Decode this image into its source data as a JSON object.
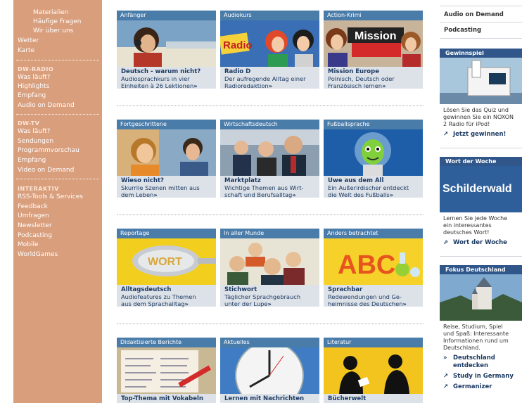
{
  "sidebar": {
    "top_items": [
      "Materialien",
      "Häufige Fragen",
      "Wir über uns"
    ],
    "main_items": [
      "Wetter",
      "Karte"
    ],
    "radio_head": "DW-RADIO",
    "radio_items": [
      "Was läuft?",
      "Highlights",
      "Empfang",
      "Audio on Demand"
    ],
    "tv_head": "DW-TV",
    "tv_items": [
      "Was läuft?",
      "Sendungen",
      "Programmvorschau",
      "Empfang",
      "Video on Demand"
    ],
    "inter_head": "INTERAKTIV",
    "inter_items": [
      "RSS-Tools & Services",
      "Feedback",
      "Umfragen",
      "Newsletter",
      "Podcasting",
      "Mobile",
      "WorldGames"
    ]
  },
  "cards": [
    {
      "header": "Anfänger",
      "title": "Deutsch - warum nicht?",
      "desc": "Audiosprachkurs in vier\nEinheiten à 26 Lektionen",
      "more": "»"
    },
    {
      "header": "Audiokurs",
      "title": "Radio D",
      "desc": "Der aufregende Alltag einer\nRadioredaktion",
      "more": "»"
    },
    {
      "header": "Action-Krimi",
      "title": "Mission Europe",
      "desc": "Polnisch, Deutsch oder\nFranzösisch lernen",
      "more": "»"
    },
    {
      "header": "Fortgeschrittene",
      "title": "Wieso nicht?",
      "desc": "Skurrile Szenen mitten aus\ndem Leben",
      "more": "»"
    },
    {
      "header": "Wirtschaftsdeutsch",
      "title": "Marktplatz",
      "desc": "Wichtige Themen aus Wirt-\nschaft und Berufsalltag",
      "more": "»"
    },
    {
      "header": "Fußballsprache",
      "title": "Uwe aus dem All",
      "desc": "Ein Außerirdischer entdeckt\ndie Welt des Fußballs",
      "more": "»"
    },
    {
      "header": "Reportage",
      "title": "Alltagsdeutsch",
      "desc": "Audiofeatures zu Themen\naus dem Sprachalltag",
      "more": "»"
    },
    {
      "header": "In aller Munde",
      "title": "Stichwort",
      "desc": "Täglicher Sprachgebrauch\nunter der Lupe",
      "more": "»"
    },
    {
      "header": "Anders betrachtet",
      "title": "Sprachbar",
      "desc": "Redewendungen und Ge-\nheimnisse des Deutschen",
      "more": "»"
    },
    {
      "header": "Didaktisierte Berichte",
      "title": "Top-Thema mit Vokabeln",
      "desc": "",
      "more": ""
    },
    {
      "header": "Aktuelles",
      "title": "Lernen mit Nachrichten",
      "desc": "",
      "more": ""
    },
    {
      "header": "Literatur",
      "title": "Bücherwelt",
      "desc": "",
      "more": ""
    }
  ],
  "radio_logo": "Radio",
  "mission_logo": "Mission",
  "abc_text": "ABC",
  "wort_text": "WORT",
  "right": {
    "links": [
      "Audio on Demand",
      "Podcasting"
    ],
    "gewinnspiel": {
      "header": "Gewinnspiel",
      "text": "Lösen Sie das Quiz und\ngewinnen Sie ein NOXON\n2 Radio für iPod!",
      "link": "Jetzt gewinnen!"
    },
    "wort": {
      "header": "Wort der Woche",
      "image_text": "Schilderwald",
      "text": "Lernen Sie jede Woche\nein interessantes\ndeutsches Wort!",
      "link": "Wort der Woche"
    },
    "fokus": {
      "header": "Fokus Deutschland",
      "text": "Reise, Studium, Spiel\nund Spaß: Interessante\nInformationen rund um\nDeutschland.",
      "links": [
        "Deutschland\nentdecken",
        "Study in Germany",
        "Germanizer"
      ]
    }
  },
  "colors": {
    "sidebar": "#d99e7c",
    "card_header": "#4a7caa",
    "card_bg": "#dde2e8",
    "title": "#1c3a63",
    "right_header": "#31578a"
  }
}
